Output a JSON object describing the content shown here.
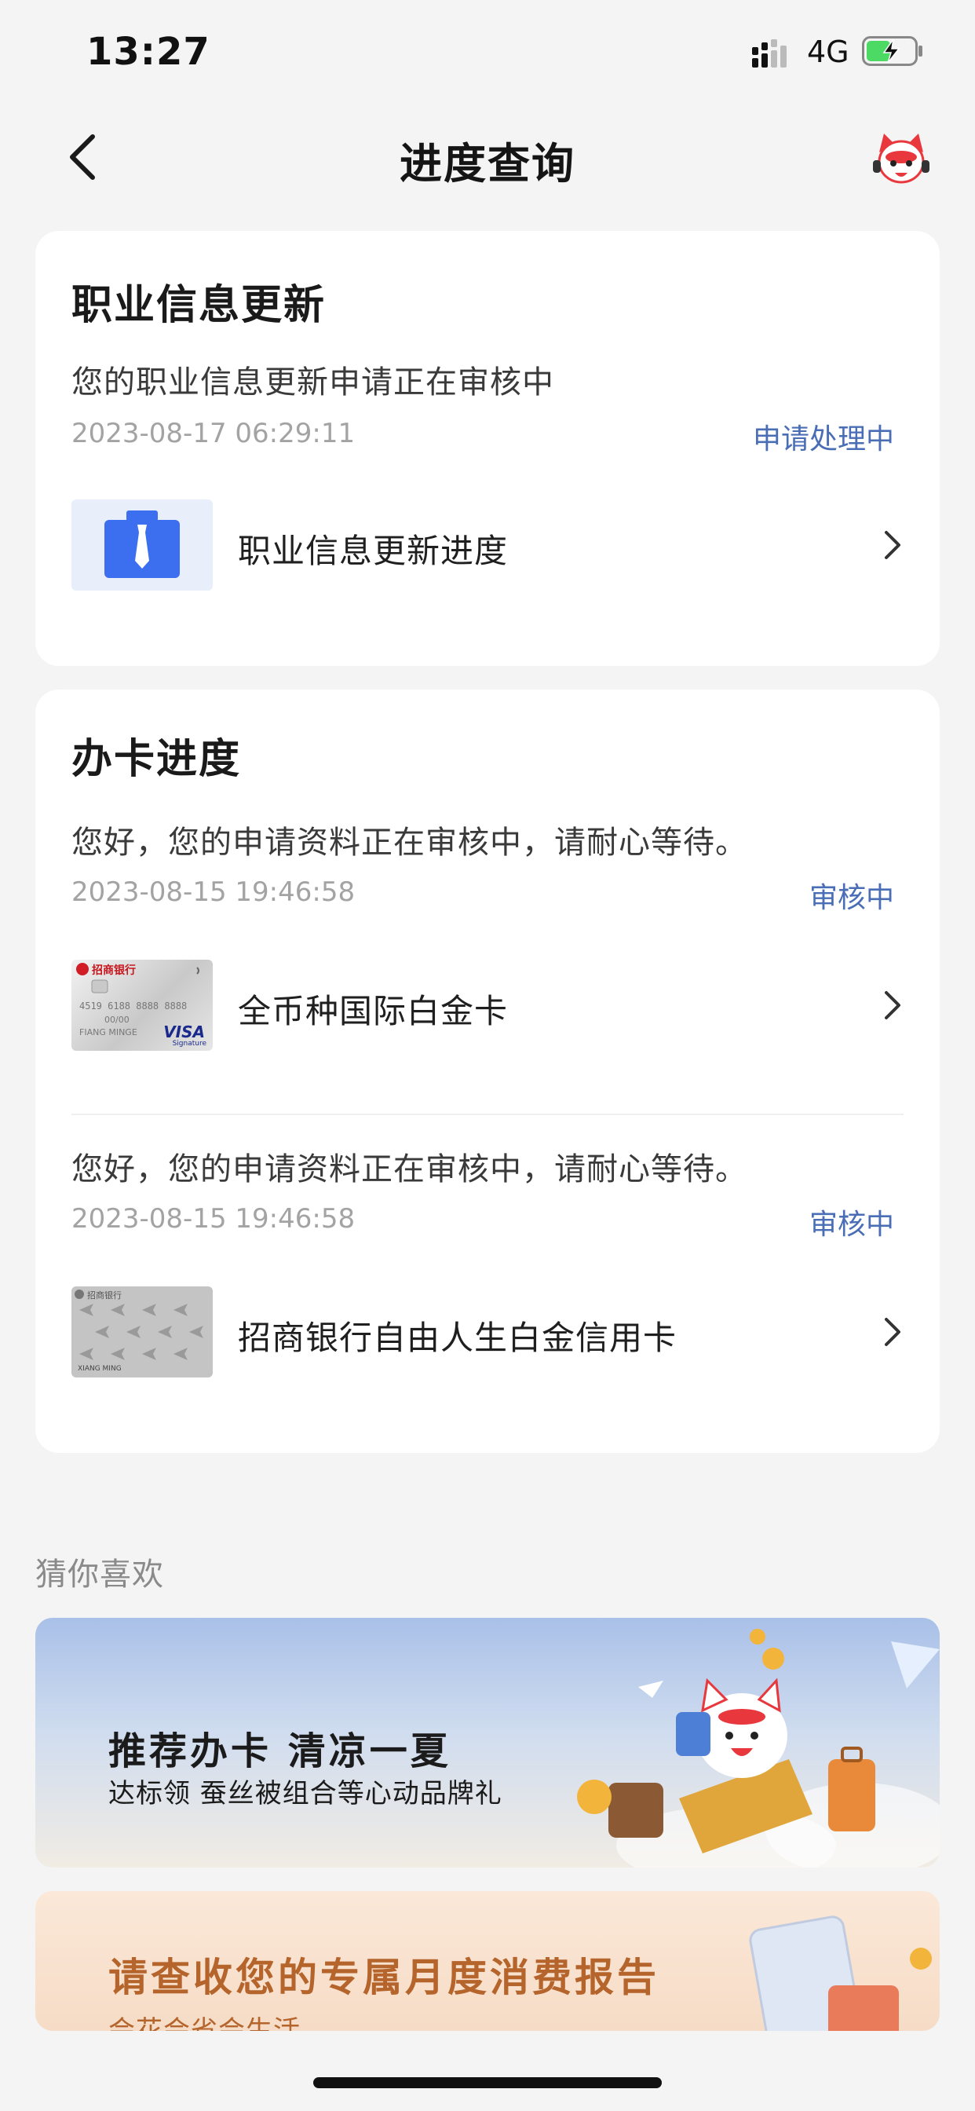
{
  "status_bar": {
    "time": "13:27",
    "network": "4G",
    "battery_icon": "battery-charging-icon",
    "signal_icon": "signal-icon"
  },
  "nav": {
    "title": "进度查询",
    "back_icon": "chevron-left-icon",
    "service_icon": "mascot-service-icon"
  },
  "occupation_card": {
    "title": "职业信息更新",
    "message": "您的职业信息更新申请正在审核中",
    "date": "2023-08-17 06:29:11",
    "status": "申请处理中",
    "item_label": "职业信息更新进度",
    "item_icon": "briefcase-icon"
  },
  "card_progress": {
    "title": "办卡进度",
    "applications": [
      {
        "message": "您好，您的申请资料正在审核中，请耐心等待。",
        "date": "2023-08-15 19:46:58",
        "status": "审核中",
        "card_name": "全币种国际白金卡",
        "card_image": "platinum-visa-card-image",
        "card_text": {
          "bank": "招商银行",
          "number": "4519 6188 8888 8888",
          "valid": "00/00",
          "holder": "FIANG MINGE",
          "brand": "VISA",
          "brand_sub": "Signature"
        }
      },
      {
        "message": "您好，您的申请资料正在审核中，请耐心等待。",
        "date": "2023-08-15 19:46:58",
        "status": "审核中",
        "card_name": "招商银行自由人生白金信用卡",
        "card_image": "free-life-platinum-card-image",
        "card_text": {
          "bank": "招商银行",
          "holder": "XIANG MING"
        }
      }
    ]
  },
  "recommend": {
    "title": "猜你喜欢",
    "banners": [
      {
        "title": "推荐办卡 清凉一夏",
        "subtitle": "达标领 蚕丝被组合等心动品牌礼",
        "image": "mascot-credit-card-travel-illustration"
      },
      {
        "title": "请查收您的专属月度消费报告",
        "subtitle": "会花会省会生活",
        "image": "phone-report-illustration"
      }
    ]
  },
  "colors": {
    "accent_status": "#4a6eb6",
    "background": "#f4f4f5",
    "card": "#ffffff",
    "banner2_title": "#b5642b"
  }
}
